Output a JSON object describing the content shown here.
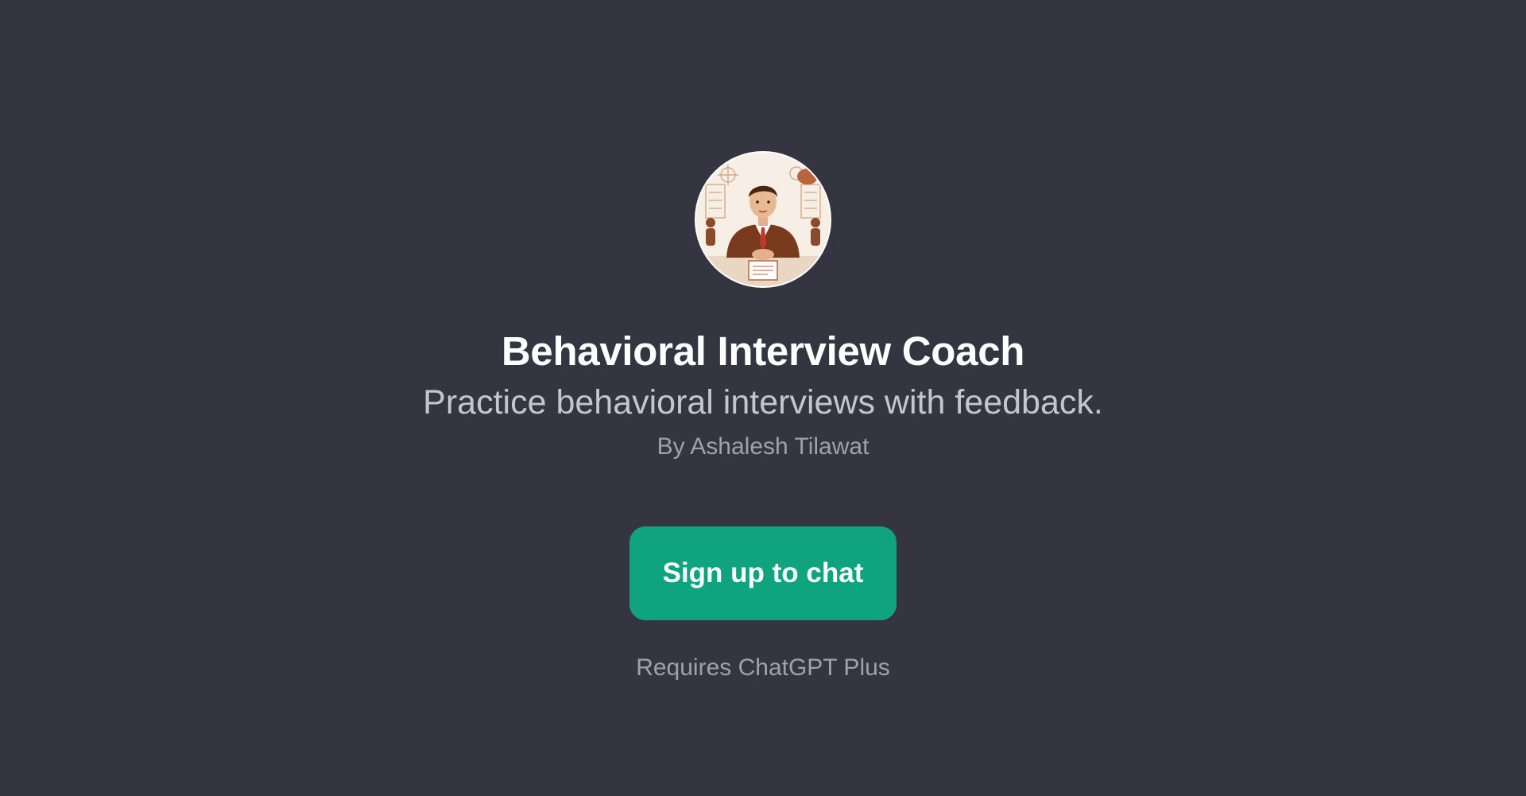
{
  "gpt": {
    "avatar_icon": "interview-coach-portrait-icon",
    "title": "Behavioral Interview Coach",
    "description": "Practice behavioral interviews with feedback.",
    "author": "By Ashalesh Tilawat"
  },
  "cta": {
    "label": "Sign up to chat",
    "color": "#10a37f"
  },
  "footer": {
    "requirement": "Requires ChatGPT Plus"
  },
  "colors": {
    "background": "#343541",
    "title": "#ffffff",
    "subtitle": "#c5c5d2",
    "muted": "#a1a1ad"
  }
}
